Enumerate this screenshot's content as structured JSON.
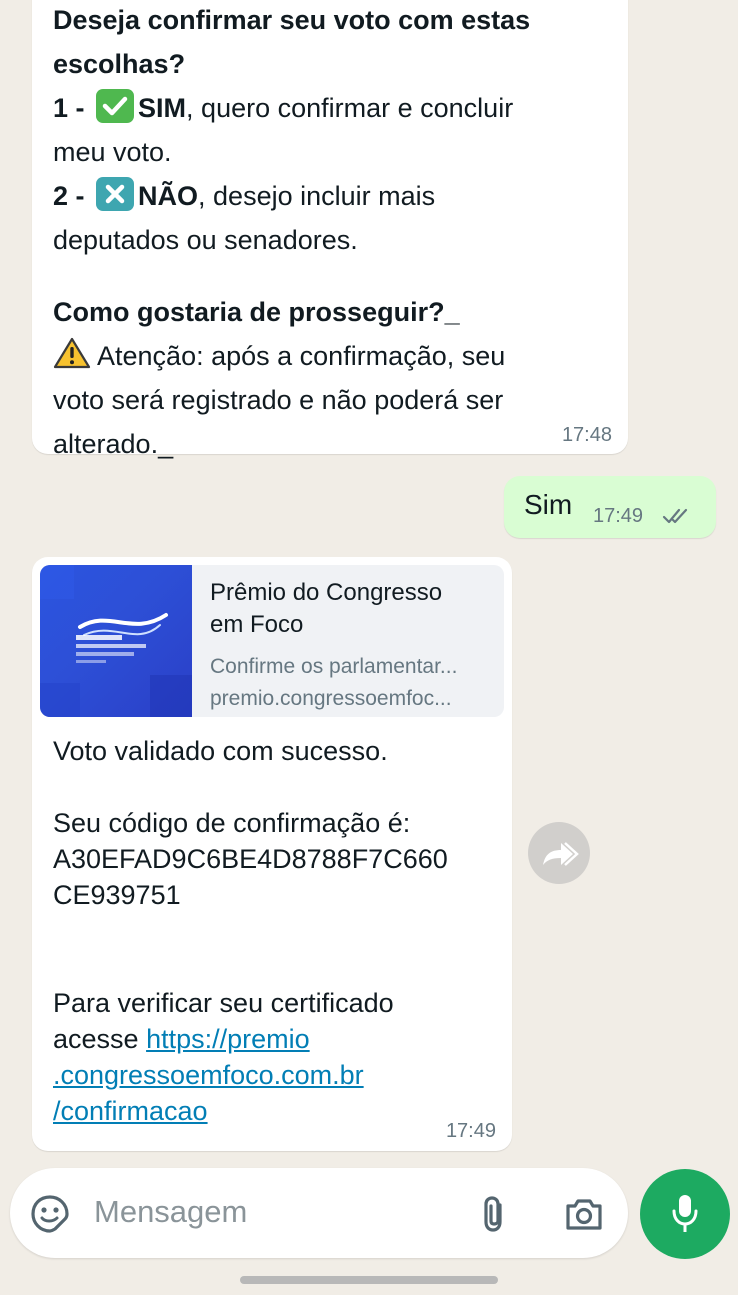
{
  "msg1": {
    "line1": "Deseja confirmar seu voto com estas",
    "line2": "escolhas?",
    "opt1_num": "1 -",
    "opt1_key": "SIM",
    "opt1_rest": ", quero confirmar e concluir",
    "opt1_line2": "meu voto.",
    "opt2_num": "2 -",
    "opt2_key": "NÃO",
    "opt2_rest": ", desejo incluir mais",
    "opt2_line2": "deputados ou senadores.",
    "question": "Como gostaria de prosseguir?_",
    "warning_line1": "Atenção: após a confirmação, seu",
    "warning_line2": "voto será registrado e não poderá ser",
    "warning_line3": "alterado._",
    "time": "17:48"
  },
  "msg2": {
    "text": "Sim",
    "time": "17:49"
  },
  "msg3": {
    "preview": {
      "title_line1": "Prêmio do Congresso",
      "title_line2": "em Foco",
      "description": "Confirme os parlamentar...",
      "url": "premio.congressoemfoc..."
    },
    "body1": "Voto validado com sucesso.",
    "body2": "Seu código de confirmação é:",
    "code_line1": "A30EFAD9C6BE4D8788F7C660",
    "code_line2": "CE939751",
    "body3_line1": "Para verificar seu certificado",
    "body3_prefix": "acesse ",
    "link_line1": "https://premio",
    "link_line2": ".congressoemfoco.com.br",
    "link_line3": "/confirmacao",
    "time": "17:49"
  },
  "input": {
    "placeholder": "Mensagem"
  },
  "icons": {
    "check": "check-mark-button",
    "cross": "cross-mark-button",
    "warning": "warning-sign",
    "read_receipt": "double-check",
    "forward": "forward-arrow",
    "emoji": "sticker-smiley",
    "attach": "paperclip",
    "camera": "camera",
    "mic": "microphone"
  },
  "colors": {
    "background": "#f1ede6",
    "incoming_bubble": "#ffffff",
    "outgoing_bubble": "#d9fdd3",
    "link": "#027eb5",
    "accent_green": "#1daa61",
    "check_green": "#4fb84f",
    "cross_teal": "#3ea6b0"
  }
}
